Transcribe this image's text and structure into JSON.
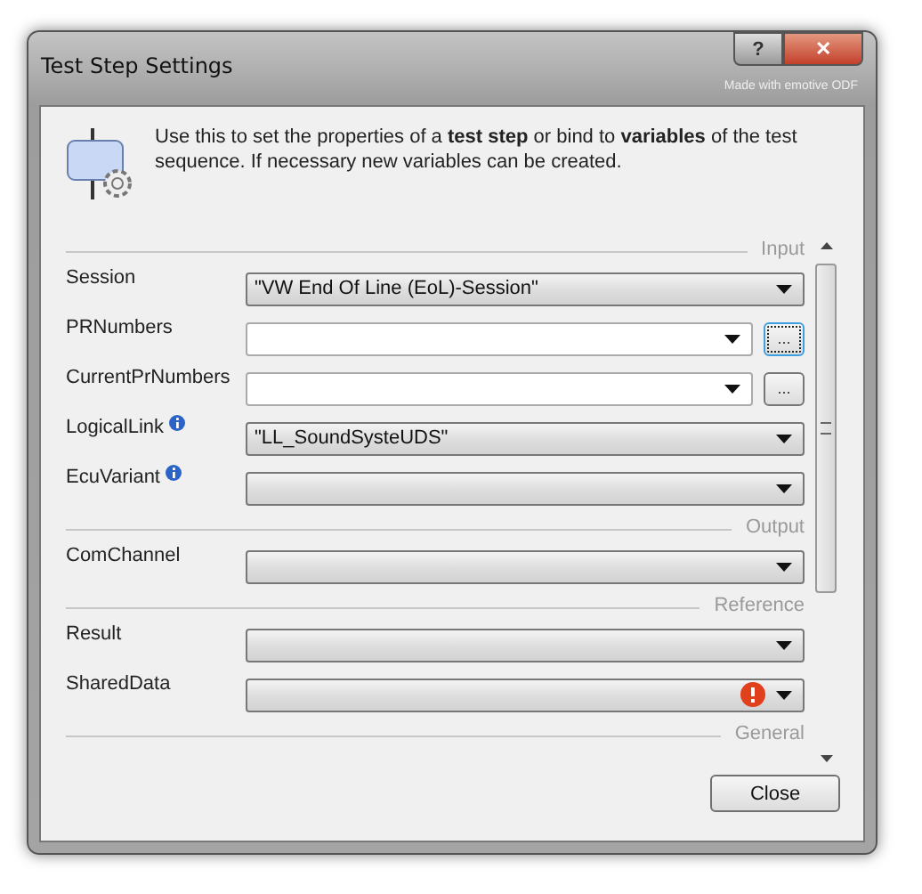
{
  "window": {
    "title": "Test Step Settings",
    "help": "?",
    "close": "✕",
    "credit": "Made with emotive ODF"
  },
  "description": "Use this to set the properties of a **test step** or bind to **variables** of the test sequence. If necessary new variables can be created.",
  "sections": [
    {
      "title": "Input",
      "fields": [
        {
          "label": "Session",
          "kind": "combo",
          "value": "\"VW End Of Line (EoL)-Session\"",
          "info": false,
          "error": false
        },
        {
          "label": "PRNumbers",
          "kind": "edit",
          "button": "...",
          "focused": true,
          "info": false,
          "error": false
        },
        {
          "label": "CurrentPrNumbers",
          "kind": "edit",
          "button": "...",
          "focused": false,
          "info": false,
          "error": false
        },
        {
          "label": "LogicalLink",
          "kind": "combo",
          "value": "\"LL_SoundSysteUDS\"",
          "info": true,
          "error": false
        },
        {
          "label": "EcuVariant",
          "kind": "combo",
          "info": true,
          "error": false
        }
      ]
    },
    {
      "title": "Output",
      "fields": [
        {
          "label": "ComChannel",
          "kind": "combo",
          "info": false,
          "error": false
        }
      ]
    },
    {
      "title": "Reference",
      "fields": [
        {
          "label": "Result",
          "kind": "combo",
          "info": false,
          "error": false
        },
        {
          "label": "SharedData",
          "kind": "combo",
          "info": false,
          "error": true
        }
      ]
    },
    {
      "title": "General"
    }
  ],
  "buttons": [
    "Close"
  ]
}
